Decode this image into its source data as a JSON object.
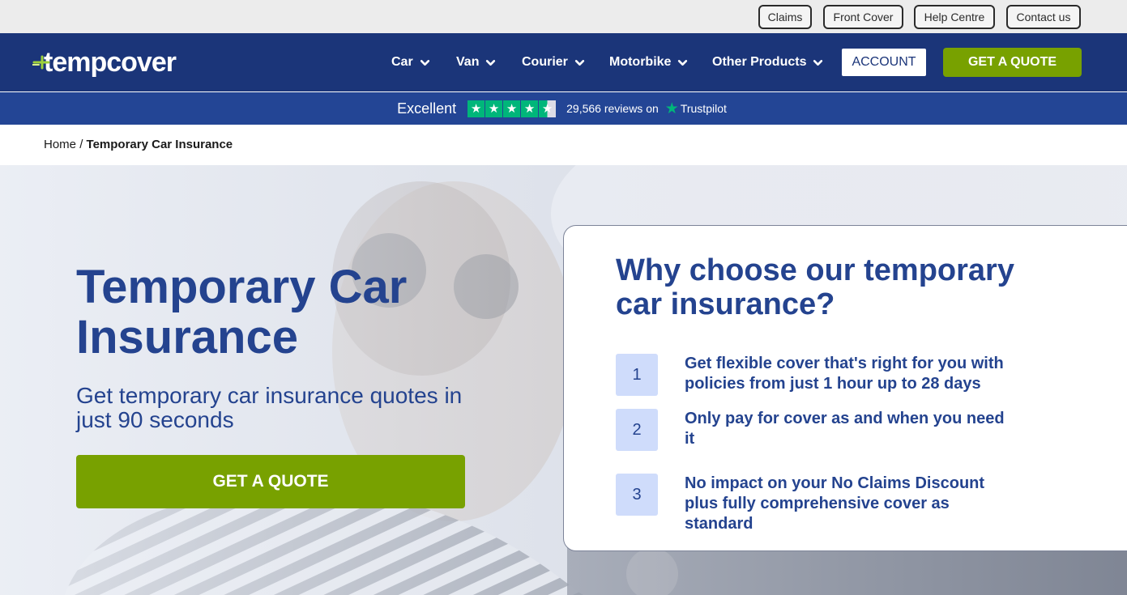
{
  "utility": {
    "claims": "Claims",
    "front_cover": "Front Cover",
    "help_centre": "Help Centre",
    "contact_us": "Contact us"
  },
  "nav": {
    "logo_text": "tempcover",
    "items": [
      {
        "label": "Car"
      },
      {
        "label": "Van"
      },
      {
        "label": "Courier"
      },
      {
        "label": "Motorbike"
      },
      {
        "label": "Other Products"
      }
    ],
    "account_label": "ACCOUNT",
    "quote_label": "GET A QUOTE"
  },
  "trustpilot": {
    "rating_text": "Excellent",
    "stars": 4.5,
    "reviews_text": "29,566 reviews on",
    "brand": "Trustpilot"
  },
  "breadcrumb": {
    "home": "Home",
    "separator": "/",
    "current": "Temporary Car Insurance"
  },
  "hero": {
    "title": "Temporary Car Insurance",
    "subtitle": "Get temporary car insurance quotes in just 90 seconds",
    "cta": "GET A QUOTE"
  },
  "why": {
    "title": "Why choose our temporary car insurance?",
    "reasons": [
      {
        "num": "1",
        "text": "Get flexible cover that's right for you with policies from just 1 hour up to 28 days"
      },
      {
        "num": "2",
        "text": "Only pay for cover as and when you need it"
      },
      {
        "num": "3",
        "text": "No impact on your No Claims Discount plus fully comprehensive cover as standard"
      }
    ]
  },
  "colors": {
    "brand_navy": "#1b3579",
    "trust_bar": "#234595",
    "accent_green": "#78a100",
    "heading_blue": "#24438f",
    "number_badge": "#cfdcfb",
    "trustpilot_green": "#00b67a"
  }
}
